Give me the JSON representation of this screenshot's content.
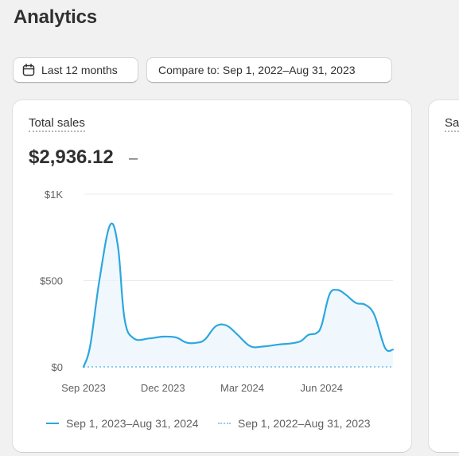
{
  "page": {
    "title": "Analytics"
  },
  "filters": {
    "range_label": "Last 12 months",
    "compare_label": "Compare to: Sep 1, 2022–Aug 31, 2023"
  },
  "cards": {
    "total_sales": {
      "label": "Total sales",
      "value": "$2,936.12",
      "change": "–"
    },
    "next_card": {
      "label": "Sa"
    }
  },
  "colors": {
    "current_series": "#2ca7df",
    "previous_series": "#8fcdef",
    "area_fill": "#e9f5fc",
    "grid": "#ececec"
  },
  "chart_data": {
    "type": "area",
    "ylim": [
      0,
      1000
    ],
    "y_ticks": [
      {
        "value": 0,
        "label": "$0"
      },
      {
        "value": 500,
        "label": "$500"
      },
      {
        "value": 1000,
        "label": "$1K"
      }
    ],
    "x_ticks": [
      "Sep 2023",
      "Dec 2023",
      "Mar 2024",
      "Jun 2024"
    ],
    "x_tick_positions": [
      0,
      3,
      6,
      9
    ],
    "x_max": 11.7,
    "grid": true,
    "legend_position": "bottom",
    "series": [
      {
        "name": "Sep 1, 2023–Aug 31, 2024",
        "style": "solid",
        "x": [
          0,
          0.25,
          0.6,
          1.0,
          1.3,
          1.55,
          1.9,
          2.5,
          3.0,
          3.5,
          3.9,
          4.3,
          4.6,
          5.0,
          5.4,
          5.8,
          6.3,
          6.8,
          7.4,
          7.8,
          8.2,
          8.5,
          8.8,
          9.0,
          9.3,
          9.6,
          9.9,
          10.3,
          10.65,
          11.0,
          11.4,
          11.7
        ],
        "values": [
          0,
          120,
          500,
          820,
          700,
          280,
          165,
          165,
          175,
          170,
          140,
          140,
          160,
          235,
          240,
          190,
          120,
          118,
          130,
          135,
          148,
          185,
          195,
          240,
          420,
          445,
          420,
          370,
          360,
          300,
          110,
          100
        ]
      },
      {
        "name": "Sep 1, 2022–Aug 31, 2023",
        "style": "dotted",
        "x": [
          0,
          11.7
        ],
        "values": [
          0,
          0
        ]
      }
    ]
  }
}
